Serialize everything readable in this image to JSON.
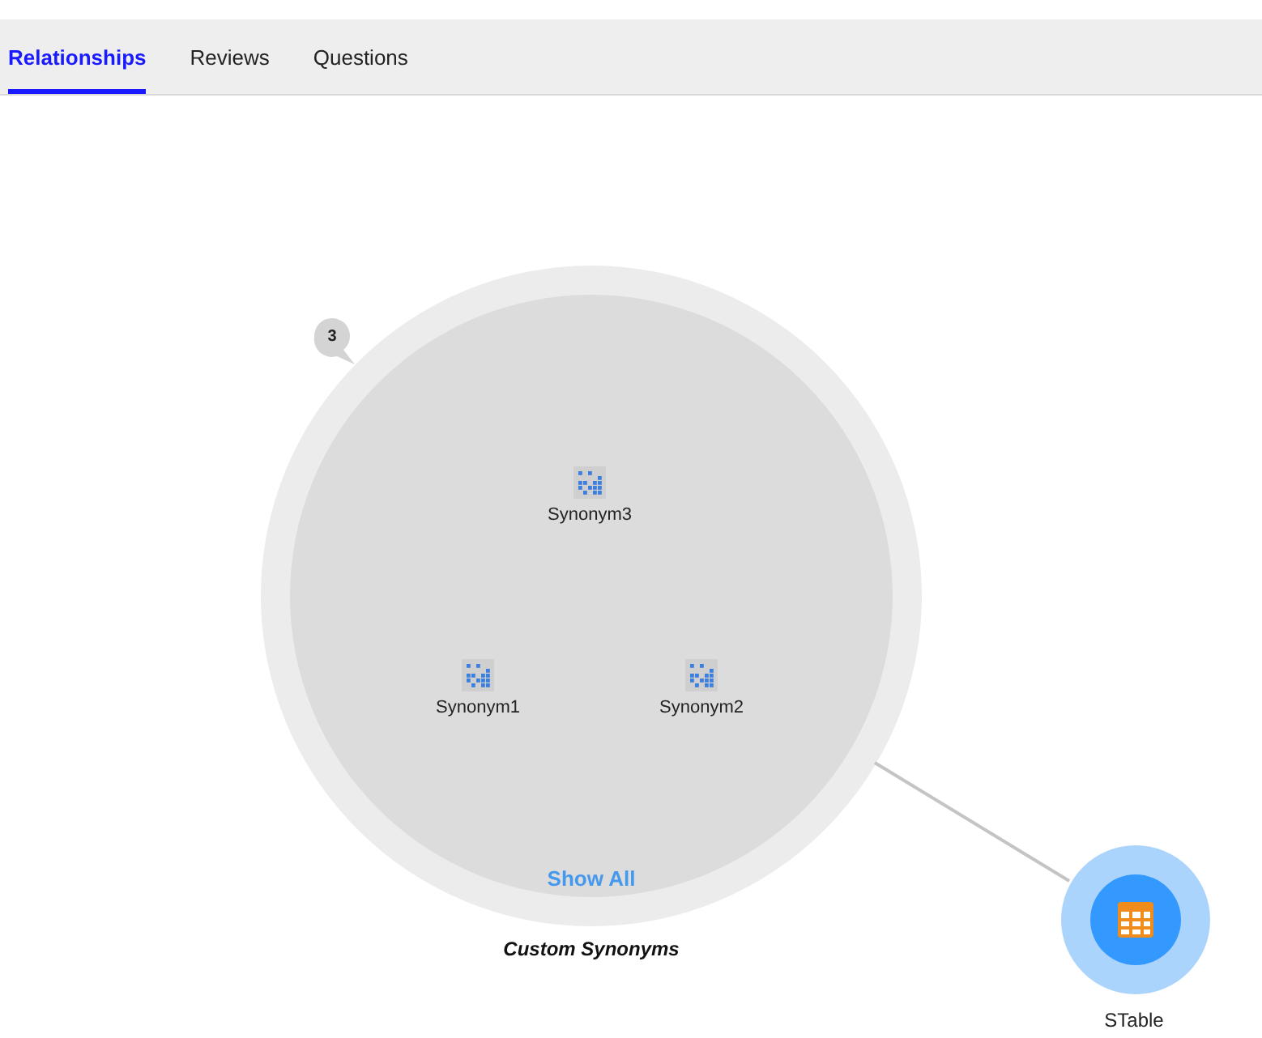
{
  "tabs": [
    {
      "label": "Relationships",
      "selected": true
    },
    {
      "label": "Reviews",
      "selected": false
    },
    {
      "label": "Questions",
      "selected": false
    }
  ],
  "cluster": {
    "count": "3",
    "nodes": [
      {
        "label": "Synonym3"
      },
      {
        "label": "Synonym1"
      },
      {
        "label": "Synonym2"
      }
    ],
    "show_all": "Show All",
    "caption": "Custom Synonyms"
  },
  "table_node": {
    "label": "STable"
  }
}
